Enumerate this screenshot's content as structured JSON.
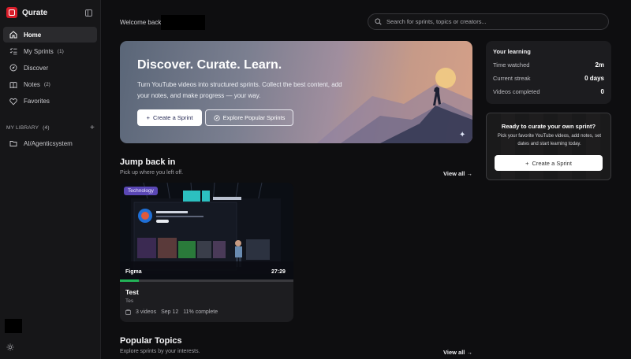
{
  "app": {
    "name": "Qurate",
    "accent": "#d81d2a"
  },
  "sidebar": {
    "items": [
      {
        "label": "Home",
        "icon": "home-icon",
        "count": ""
      },
      {
        "label": "My Sprints",
        "icon": "checklist-icon",
        "count": "(1)"
      },
      {
        "label": "Discover",
        "icon": "compass-icon",
        "count": ""
      },
      {
        "label": "Notes",
        "icon": "book-icon",
        "count": "(2)"
      },
      {
        "label": "Favorites",
        "icon": "heart-icon",
        "count": ""
      }
    ],
    "library": {
      "label": "MY LIBRARY",
      "count": "(4)",
      "items": [
        {
          "label": "AI/Agenticsystem",
          "icon": "folder-icon"
        }
      ]
    }
  },
  "header": {
    "welcome": "Welcome back,",
    "search_placeholder": "Search for sprints, topics or creators..."
  },
  "hero": {
    "title": "Discover. Curate. Learn.",
    "subtitle": "Turn YouTube videos into structured sprints. Collect the best content, add your notes, and make progress — your way.",
    "primary_label": "Create a Sprint",
    "secondary_label": "Explore Popular Sprints"
  },
  "learning": {
    "title": "Your learning",
    "rows": [
      {
        "label": "Time watched",
        "value": "2m"
      },
      {
        "label": "Current streak",
        "value": "0 days"
      },
      {
        "label": "Videos completed",
        "value": "0"
      }
    ]
  },
  "cta": {
    "title": "Ready to curate your own sprint?",
    "subtitle": "Pick your favorite YouTube videos, add notes, set dates and start learning today.",
    "button_label": "Create a Sprint"
  },
  "jump_back": {
    "title": "Jump back in",
    "subtitle": "Pick up where you left off.",
    "view_all": "View all",
    "card": {
      "tag": "Technology",
      "channel": "Figma",
      "duration": "27:29",
      "title": "Test",
      "description": "Tes",
      "videos": "3 videos",
      "date": "Sep 12",
      "progress_text": "11% complete",
      "progress": 0.11,
      "progress_color": "#23b357",
      "tag_color": "#5a47b5"
    }
  },
  "popular": {
    "title": "Popular Topics",
    "subtitle": "Explore sprints by your interests.",
    "view_all": "View all"
  }
}
